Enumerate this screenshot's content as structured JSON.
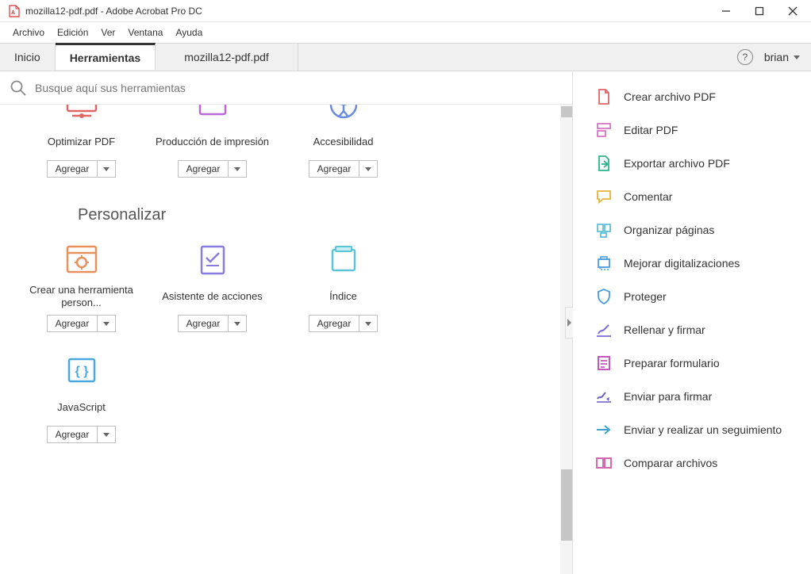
{
  "window": {
    "title": "mozilla12-pdf.pdf - Adobe Acrobat Pro DC"
  },
  "menubar": [
    "Archivo",
    "Edición",
    "Ver",
    "Ventana",
    "Ayuda"
  ],
  "tabs": {
    "home": "Inicio",
    "tools": "Herramientas",
    "doc": "mozilla12-pdf.pdf"
  },
  "user": "brian",
  "search": {
    "placeholder": "Busque aquí sus herramientas"
  },
  "row1": [
    {
      "label": "Optimizar PDF",
      "add": "Agregar",
      "color": "#e06666"
    },
    {
      "label": "Producción de impresión",
      "add": "Agregar",
      "color": "#b96ad9"
    },
    {
      "label": "Accesibilidad",
      "add": "Agregar",
      "color": "#6a8de0"
    }
  ],
  "section": "Personalizar",
  "row2": [
    {
      "label": "Crear una herramienta person...",
      "add": "Agregar"
    },
    {
      "label": "Asistente de acciones",
      "add": "Agregar"
    },
    {
      "label": "Índice",
      "add": "Agregar"
    }
  ],
  "row3": [
    {
      "label": "JavaScript",
      "add": "Agregar"
    }
  ],
  "rightPanel": [
    {
      "label": "Crear archivo PDF",
      "icon": "create-pdf"
    },
    {
      "label": "Editar PDF",
      "icon": "edit-pdf"
    },
    {
      "label": "Exportar archivo PDF",
      "icon": "export-pdf"
    },
    {
      "label": "Comentar",
      "icon": "comment"
    },
    {
      "label": "Organizar páginas",
      "icon": "organize"
    },
    {
      "label": "Mejorar digitalizaciones",
      "icon": "enhance"
    },
    {
      "label": "Proteger",
      "icon": "protect"
    },
    {
      "label": "Rellenar y firmar",
      "icon": "fill-sign"
    },
    {
      "label": "Preparar formulario",
      "icon": "form"
    },
    {
      "label": "Enviar para firmar",
      "icon": "send-sign"
    },
    {
      "label": "Enviar y realizar un seguimiento",
      "icon": "send-track"
    },
    {
      "label": "Comparar archivos",
      "icon": "compare"
    }
  ]
}
